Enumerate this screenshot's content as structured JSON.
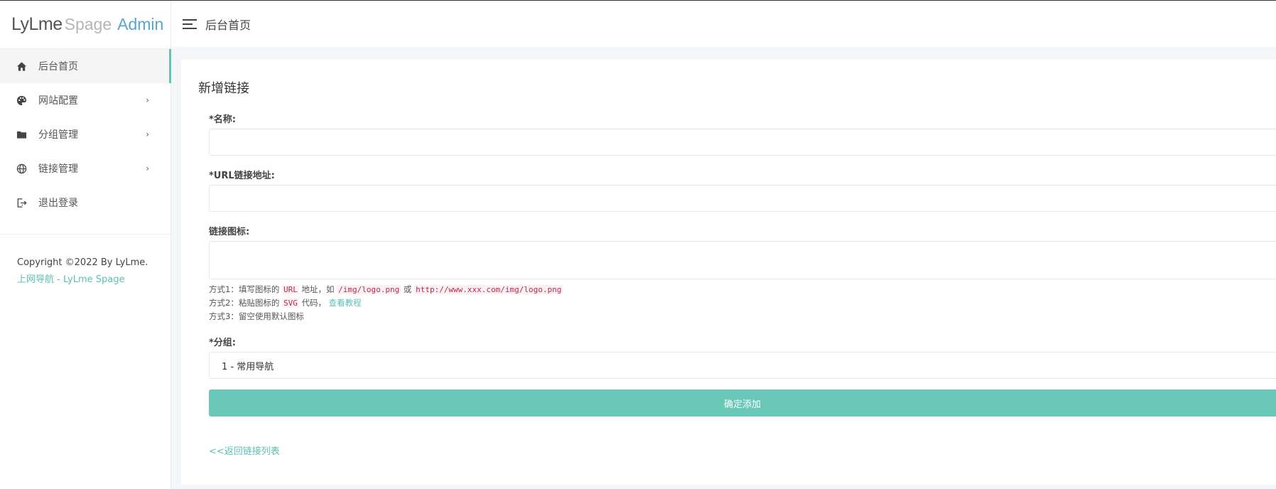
{
  "logo": {
    "part1": "LyLme",
    "part2": "Spage",
    "part3": "Admin"
  },
  "header": {
    "title": "后台首页"
  },
  "sidebar": {
    "items": [
      {
        "label": "后台首页",
        "icon": "home-icon",
        "active": true
      },
      {
        "label": "网站配置",
        "icon": "palette-icon",
        "chevron": "›"
      },
      {
        "label": "分组管理",
        "icon": "folder-icon",
        "chevron": "›"
      },
      {
        "label": "链接管理",
        "icon": "globe-icon",
        "chevron": "›"
      },
      {
        "label": "退出登录",
        "icon": "logout-icon"
      }
    ],
    "copyright": "Copyright ©2022 By LyLme.",
    "footer_link": "上网导航 - LyLme Spage"
  },
  "form": {
    "title": "新增链接",
    "name_label": "*名称:",
    "url_label": "*URL链接地址:",
    "icon_label": "链接图标:",
    "help": {
      "line1_prefix": "方式1：填写图标的",
      "line1_code1": "URL",
      "line1_mid": "地址，如",
      "line1_code2": "/img/logo.png",
      "line1_or": "或",
      "line1_code3": "http://www.xxx.com/img/logo.png",
      "line2_prefix": "方式2：粘贴图标的",
      "line2_code": "SVG",
      "line2_mid": "代码，",
      "line2_link": "查看教程",
      "line3": "方式3：留空使用默认图标"
    },
    "group_label": "*分组:",
    "group_value": "1 - 常用导航",
    "submit_label": "确定添加",
    "back_link": "<<返回链接列表"
  },
  "colors": {
    "accent": "#6ac8b9",
    "link": "#5dbfb0",
    "admin": "#5aa5d0"
  }
}
